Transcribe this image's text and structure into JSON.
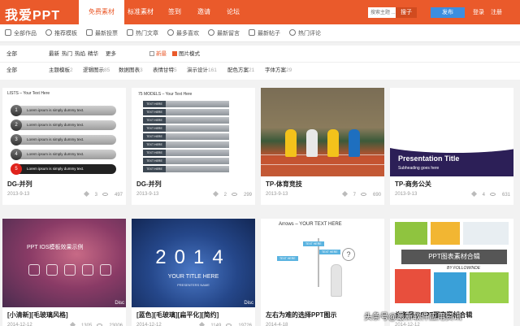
{
  "brand": {
    "logo": "我爱PPT",
    "accent": "#ea5a2b"
  },
  "nav": {
    "items": [
      {
        "label": "免费素材"
      },
      {
        "label": "标准素材"
      },
      {
        "label": "签到"
      },
      {
        "label": "邀请"
      },
      {
        "label": "论坛"
      }
    ],
    "search_placeholder": "搜索主题 ...",
    "search_button": "搜子",
    "publish_button": "发布",
    "login": "登录",
    "register": "注册"
  },
  "subnav": {
    "items": [
      {
        "label": "全部作品"
      },
      {
        "label": "推荐模板"
      },
      {
        "label": "最新投票"
      },
      {
        "label": "热门文章"
      },
      {
        "label": "最多喜欢"
      },
      {
        "label": "最新留言"
      },
      {
        "label": "最新帖子"
      },
      {
        "label": "热门评论"
      }
    ]
  },
  "filters": {
    "row1": {
      "label": "全部",
      "sorts": [
        "最新",
        "热门",
        "热焰",
        "精华",
        "更多"
      ],
      "checks": [
        {
          "label": "新最",
          "checked": false
        },
        {
          "label": "图片模式",
          "checked": true
        }
      ]
    },
    "row2": {
      "label": "全部",
      "categories": [
        {
          "label": "主题模板",
          "count": "2"
        },
        {
          "label": "逻辑图示",
          "count": "85"
        },
        {
          "label": "数据图表",
          "count": "3"
        },
        {
          "label": "表情甘特",
          "count": "5"
        },
        {
          "label": "演示设计",
          "count": "161"
        },
        {
          "label": "配色方案",
          "count": "21"
        },
        {
          "label": "字体方案",
          "count": "29"
        }
      ]
    }
  },
  "cards": [
    {
      "title": "DG-并列",
      "date": "2013-9-13",
      "likes": "3",
      "views": "497",
      "thumb": {
        "header": "LISTS – Your Text Here",
        "row_text": "Lorem ipsum is simply dummy text.",
        "nums": [
          "1",
          "2",
          "3",
          "4",
          "5"
        ]
      }
    },
    {
      "title": "DG-并列",
      "date": "2013-9-13",
      "likes": "2",
      "views": "299",
      "thumb": {
        "header": "75 MODELS – Your Text Here",
        "labels": [
          "TEXT HERE",
          "TEXT HERE",
          "TEXT HERE",
          "TEXT HERE",
          "TEXT HERE",
          "TEXT HERE",
          "TEXT HERE",
          "TEXT HERE",
          "TEXT HERE"
        ]
      }
    },
    {
      "title": "TP-体育竞技",
      "date": "2013-9-13",
      "likes": "7",
      "views": "690"
    },
    {
      "title": "TP-商务公关",
      "date": "2013-9-13",
      "likes": "4",
      "views": "631",
      "thumb": {
        "title": "Presentation Title",
        "subtitle": "Subheading goes here"
      }
    },
    {
      "title": "[小清新][毛玻璃风格]",
      "date": "2014-12-12",
      "likes": "1305",
      "views": "23006",
      "thumb": {
        "title": "PPT IOS模板效果示例",
        "corner": "Disc"
      }
    },
    {
      "title": "[蓝色][毛玻璃][扁平化][简约]",
      "date": "2014-12-12",
      "likes": "1149",
      "views": "19726",
      "thumb": {
        "year": "2014",
        "title": "YOUR TITLE HERE",
        "presenter": "PRESENTERS NAME",
        "corner": "Disc"
      }
    },
    {
      "title": "左右为难的选择PPT图示",
      "date": "2014-4-18",
      "likes": "",
      "views": "",
      "thumb": {
        "title": "Arrows – YOUR TEXT HERE",
        "sign": "TEXT HERE",
        "question": "?"
      }
    },
    {
      "title": "头条号@PPT图表素材合辑",
      "date": "2014-12-12",
      "likes": "",
      "views": "",
      "thumb": {
        "banner": "PPT图表素材合辑",
        "by": "BY FOLLOWINDE"
      }
    }
  ],
  "watermark": "头条号@最新软件应用资讯"
}
